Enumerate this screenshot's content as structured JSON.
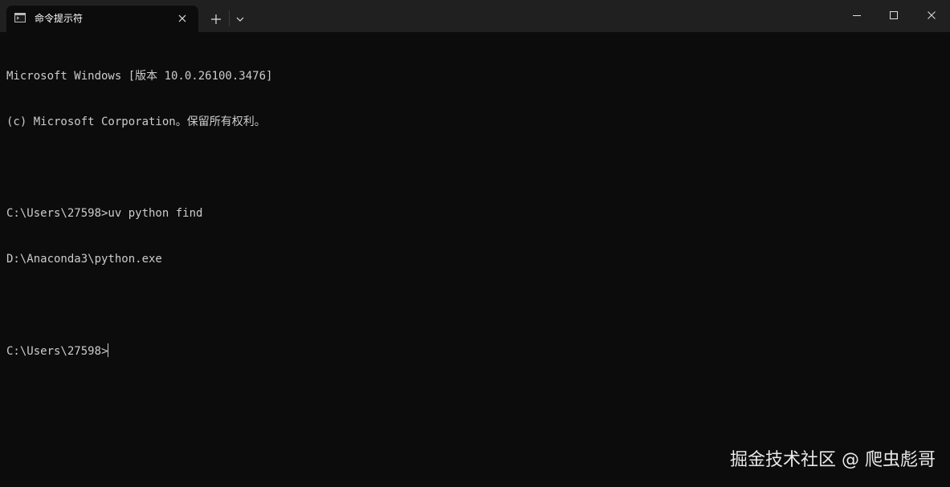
{
  "tab": {
    "title": "命令提示符",
    "icon": "terminal-icon"
  },
  "window_controls": {
    "minimize": "minimize-icon",
    "maximize": "maximize-icon",
    "close": "close-icon"
  },
  "console": {
    "lines": [
      "Microsoft Windows [版本 10.0.26100.3476]",
      "(c) Microsoft Corporation。保留所有权利。",
      "",
      "C:\\Users\\27598>uv python find",
      "D:\\Anaconda3\\python.exe",
      "",
      "C:\\Users\\27598>"
    ]
  },
  "watermark": "掘金技术社区 @ 爬虫彪哥"
}
